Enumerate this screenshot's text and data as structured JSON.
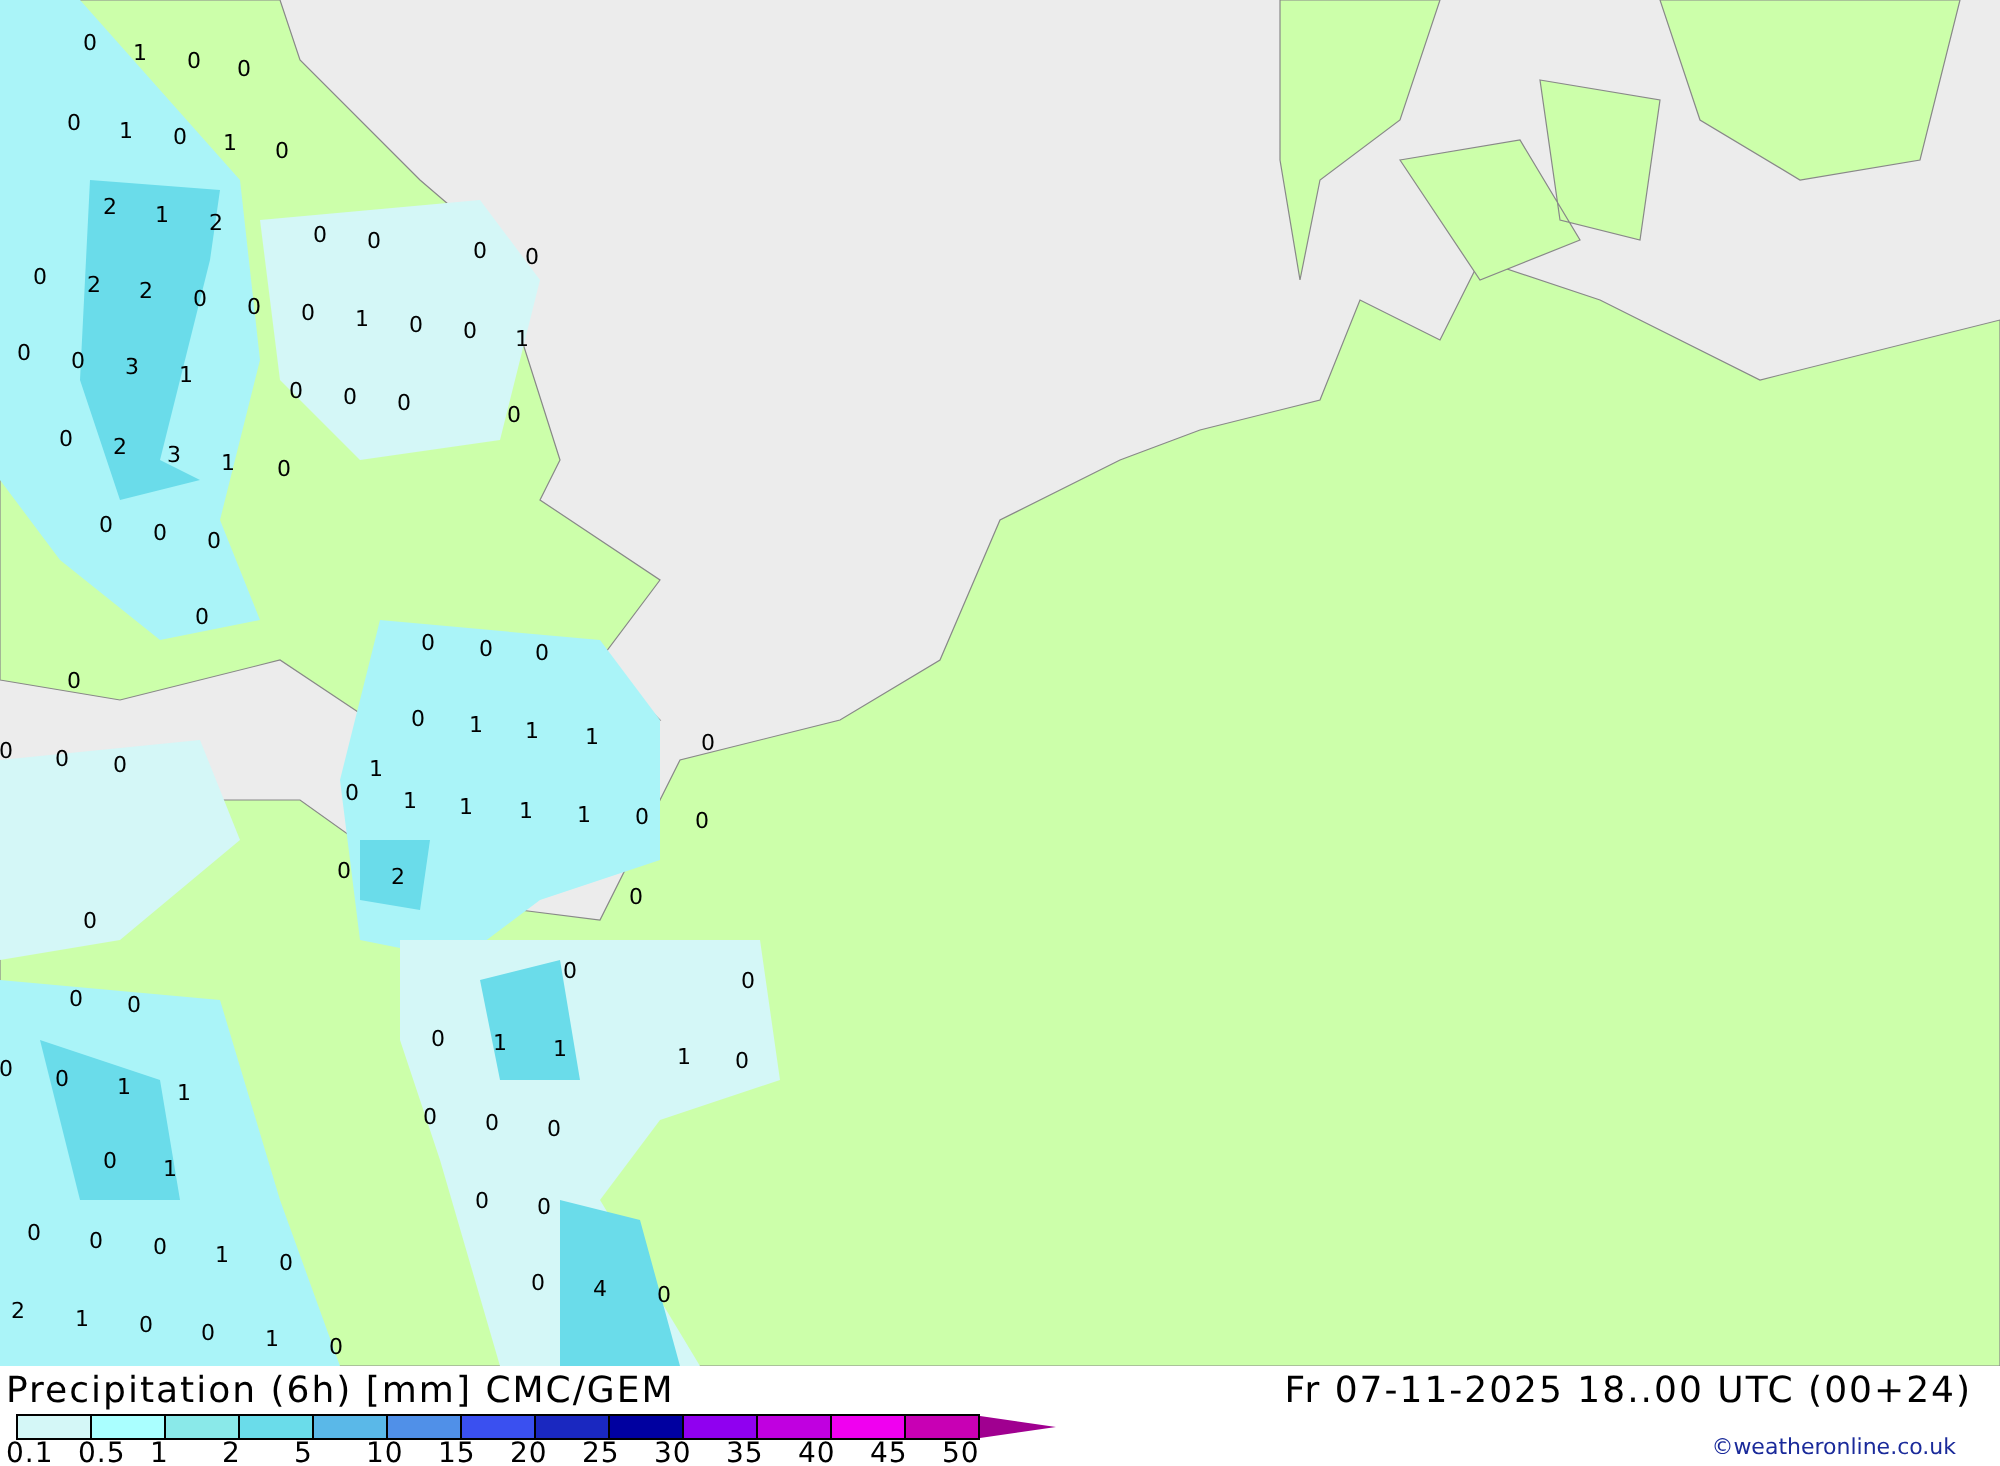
{
  "map_labels": [
    "0",
    "1",
    "0",
    "0",
    "0",
    "1",
    "0",
    "1",
    "0",
    "2",
    "1",
    "2",
    "0",
    "0",
    "0",
    "0",
    "0",
    "2",
    "2",
    "0",
    "0",
    "0",
    "1",
    "0",
    "0",
    "1",
    "0",
    "0",
    "3",
    "1",
    "0",
    "0",
    "0",
    "0",
    "0",
    "2",
    "3",
    "1",
    "0",
    "0",
    "0",
    "0",
    "0",
    "0",
    "0",
    "0",
    "0",
    "0",
    "1",
    "1",
    "1",
    "0",
    "0",
    "0",
    "0",
    "1",
    "0",
    "1",
    "1",
    "1",
    "1",
    "0",
    "0",
    "0",
    "2",
    "0",
    "0",
    "0",
    "0",
    "0",
    "0",
    "0",
    "1",
    "1",
    "1",
    "0",
    "0",
    "0",
    "1",
    "1",
    "0",
    "0",
    "0",
    "0",
    "1",
    "0",
    "0",
    "0",
    "0",
    "0",
    "1",
    "0",
    "0",
    "4",
    "0",
    "2",
    "1",
    "0",
    "0",
    "1",
    "0"
  ],
  "title": "Precipitation (6h) [mm] CMC/GEM",
  "valid_time": "Fr 07-11-2025 18..00 UTC (00+24)",
  "credit": "©weatheronline.co.uk",
  "legend": {
    "bins": [
      {
        "color": "#d4f7f7"
      },
      {
        "color": "#aaffff"
      },
      {
        "color": "#8ae9e9"
      },
      {
        "color": "#6adcea"
      },
      {
        "color": "#5ab8e8"
      },
      {
        "color": "#5090e8"
      },
      {
        "color": "#3a50f0"
      },
      {
        "color": "#1a28c0"
      },
      {
        "color": "#0000a0"
      },
      {
        "color": "#9000f0"
      },
      {
        "color": "#c000e0"
      },
      {
        "color": "#f000f0"
      },
      {
        "color": "#c800b4"
      }
    ],
    "overflow": {
      "color": "#a00090"
    },
    "ticks": [
      "0.1",
      "0.5",
      "1",
      "2",
      "5",
      "10",
      "15",
      "20",
      "25",
      "30",
      "35",
      "40",
      "45",
      "50"
    ]
  }
}
